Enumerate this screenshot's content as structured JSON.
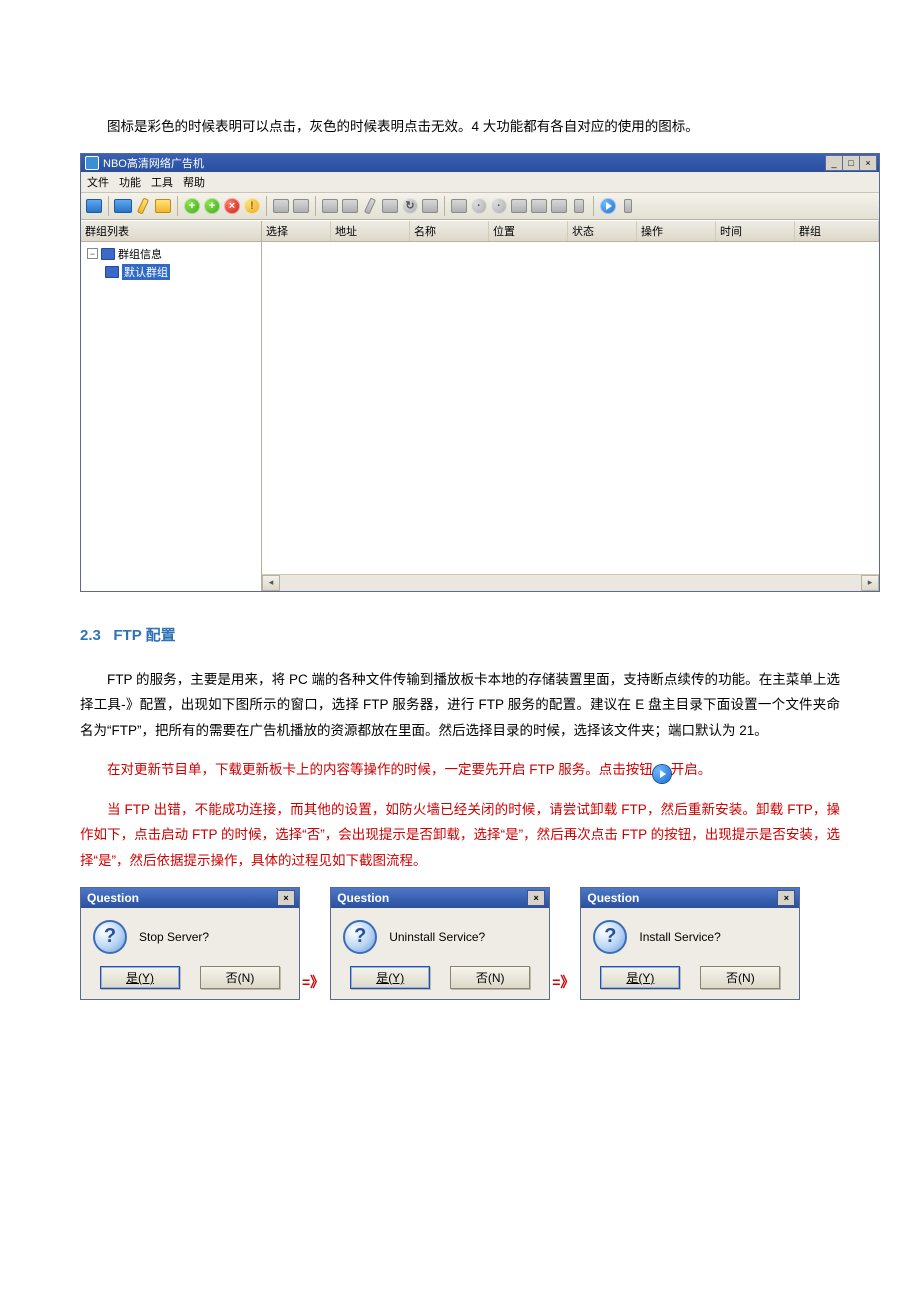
{
  "intro_text": "图标是彩色的时候表明可以点击，灰色的时候表明点击无效。4 大功能都有各自对应的使用的图标。",
  "appwin": {
    "title": "NBO高清网络广告机",
    "minimize": "_",
    "maximize": "□",
    "close": "×",
    "menu": [
      "文件",
      "功能",
      "工具",
      "帮助"
    ],
    "tree": {
      "header": "群组列表",
      "root": "群组信息",
      "child": "默认群组"
    },
    "columns": [
      "选择",
      "地址",
      "名称",
      "位置",
      "状态",
      "操作",
      "时间",
      "群组"
    ]
  },
  "section_num": "2.3",
  "section_title": "FTP 配置",
  "p1": "FTP 的服务，主要是用来，将 PC 端的各种文件传输到播放板卡本地的存储装置里面，支持断点续传的功能。在主菜单上选择工具-》配置，出现如下图所示的窗口，选择 FTP 服务器，进行 FTP 服务的配置。建议在 E 盘主目录下面设置一个文件夹命名为“FTP”，把所有的需要在广告机播放的资源都放在里面。然后选择目录的时候，选择该文件夹；端口默认为 21。",
  "p2_a": "在对更新节目单，下载更新板卡上的内容等操作的时候，一定要先开启 FTP 服务。点击按钮",
  "p2_b": "开启。",
  "p3": "当 FTP 出错，不能成功连接，而其他的设置，如防火墙已经关闭的时候，请尝试卸载 FTP，然后重新安装。卸载 FTP，操作如下，点击启动 FTP 的时候，选择“否”，会出现提示是否卸载，选择“是”，然后再次点击 FTP 的按钮，出现提示是否安装，选择“是”，然后依据提示操作，具体的过程见如下截图流程。",
  "arrow": "=》",
  "dialogs": {
    "title": "Question",
    "close": "×",
    "q": "?",
    "yes": "是(Y)",
    "no": "否(N)",
    "msg1": "Stop Server?",
    "msg2": "Uninstall Service?",
    "msg3": "Install Service?"
  }
}
